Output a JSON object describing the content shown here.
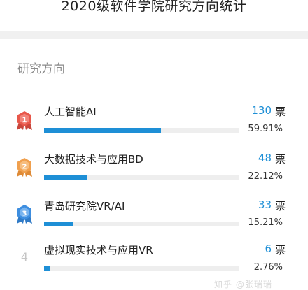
{
  "page": {
    "title": "2020级软件学院研究方向统计"
  },
  "section": {
    "title": "研究方向"
  },
  "watermark": "知乎 @张瑞瑞",
  "items": [
    {
      "rank": "1",
      "name": "人工智能AI",
      "votes": "130",
      "unit": "票",
      "percent_label": "59.91%",
      "share": 0.5991,
      "badge": "gold-medal-icon",
      "badge_color": "#e8574a"
    },
    {
      "rank": "2",
      "name": "大数据技术与应用BD",
      "votes": "48",
      "unit": "票",
      "percent_label": "22.12%",
      "share": 0.2212,
      "badge": "silver-medal-icon",
      "badge_color": "#f0a04e"
    },
    {
      "rank": "3",
      "name": "青岛研究院VR/AI",
      "votes": "33",
      "unit": "票",
      "percent_label": "15.21%",
      "share": 0.1521,
      "badge": "bronze-medal-icon",
      "badge_color": "#3d8ee0"
    },
    {
      "rank": "4",
      "name": "虚拟现实技术与应用VR",
      "votes": "6",
      "unit": "票",
      "percent_label": "2.76%",
      "share": 0.0276
    }
  ],
  "colors": {
    "accent": "#1e8fd6",
    "track": "#eeeeee",
    "divider": "#f0f0f0"
  }
}
